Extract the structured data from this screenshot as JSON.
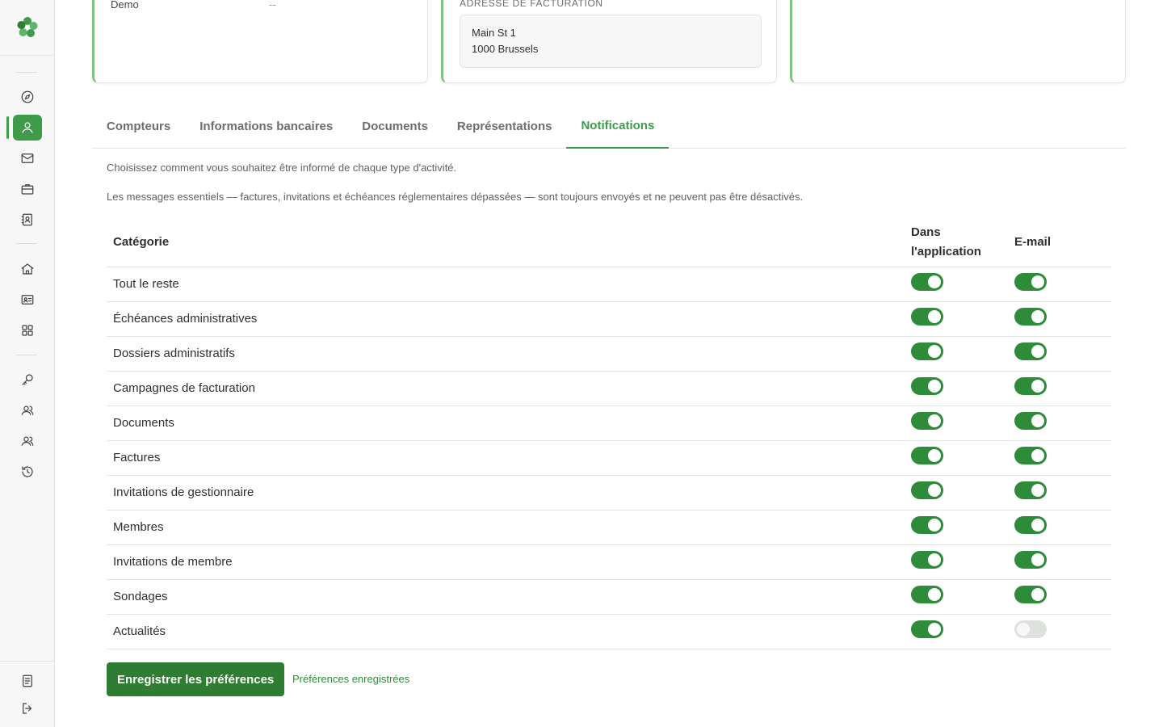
{
  "sidebar": {
    "nav": [
      "compass-icon",
      "user-icon",
      "mail-icon",
      "briefcase-icon",
      "contact-book-icon",
      "home-icon",
      "id-card-icon",
      "grid-icon",
      "key-icon",
      "users-icon",
      "team-icon",
      "history-icon"
    ],
    "active": "user-icon",
    "bottom": [
      "document-icon",
      "logout-icon"
    ],
    "accent": "#3f9a4a"
  },
  "cards": {
    "demo_label": "Demo",
    "demo_value": "--",
    "billing_label": "ADRESSE DE FACTURATION",
    "address_line1": "Main St 1",
    "address_line2": "1000 Brussels"
  },
  "tabs": [
    {
      "label": "Compteurs",
      "active": false
    },
    {
      "label": "Informations bancaires",
      "active": false
    },
    {
      "label": "Documents",
      "active": false
    },
    {
      "label": "Représentations",
      "active": false
    },
    {
      "label": "Notifications",
      "active": true
    }
  ],
  "notifications": {
    "intro": "Choisissez comment vous souhaitez être informé de chaque type d'activité.",
    "note": "Les messages essentiels — factures, invitations et échéances réglementaires dépassées — sont toujours envoyés et ne peuvent pas être désactivés.",
    "columns": {
      "category": "Catégorie",
      "in_app_line1": "Dans",
      "in_app_line2": "l'application",
      "email": "E-mail"
    },
    "rows": [
      {
        "label": "Tout le reste",
        "in_app": true,
        "email": true
      },
      {
        "label": "Échéances administratives",
        "in_app": true,
        "email": true
      },
      {
        "label": "Dossiers administratifs",
        "in_app": true,
        "email": true
      },
      {
        "label": "Campagnes de facturation",
        "in_app": true,
        "email": true
      },
      {
        "label": "Documents",
        "in_app": true,
        "email": true
      },
      {
        "label": "Factures",
        "in_app": true,
        "email": true
      },
      {
        "label": "Invitations de gestionnaire",
        "in_app": true,
        "email": true
      },
      {
        "label": "Membres",
        "in_app": true,
        "email": true
      },
      {
        "label": "Invitations de membre",
        "in_app": true,
        "email": true
      },
      {
        "label": "Sondages",
        "in_app": true,
        "email": true
      },
      {
        "label": "Actualités",
        "in_app": true,
        "email": false
      }
    ],
    "save_label": "Enregistrer les préférences",
    "saved_status": "Préférences enregistrées"
  },
  "colors": {
    "toggle_on": "#2e8b3a",
    "toggle_off": "#dfe1df",
    "button": "#2e7d32"
  }
}
